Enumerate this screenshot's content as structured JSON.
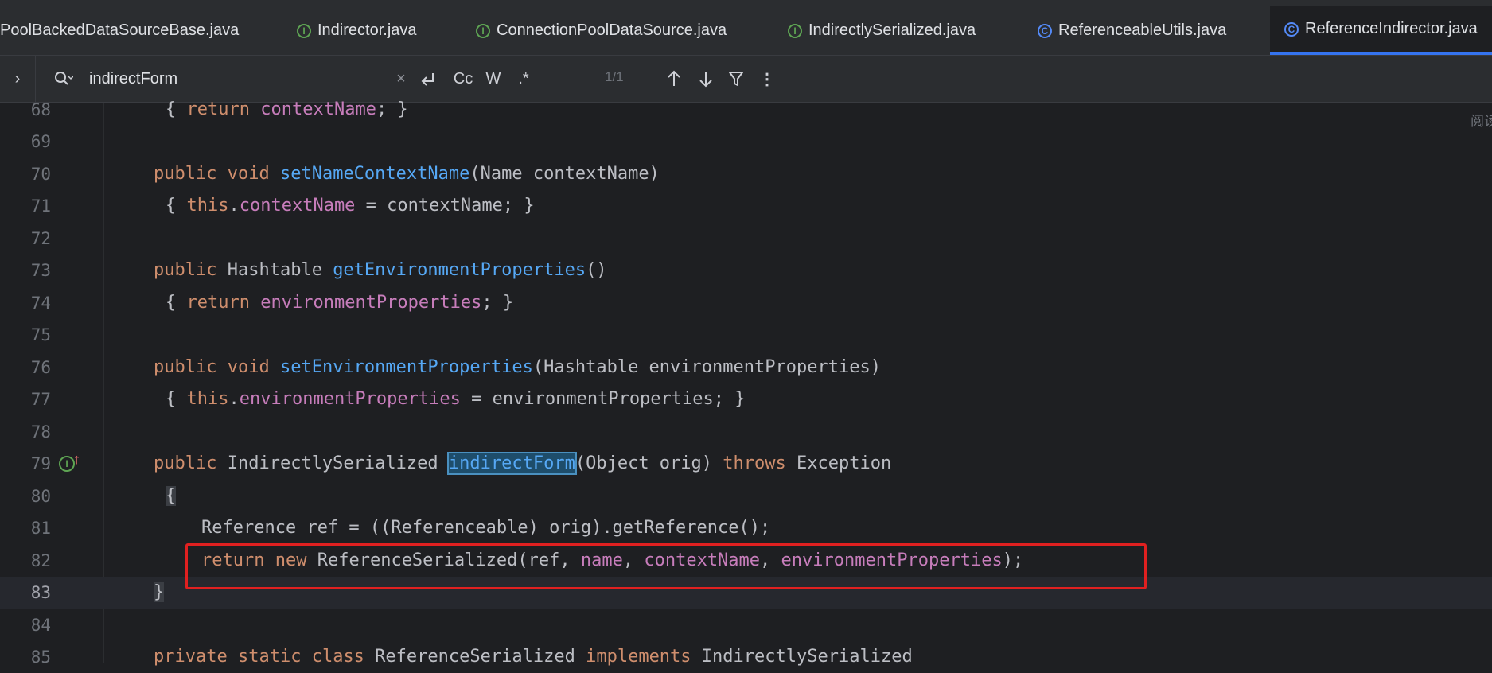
{
  "tabs": [
    {
      "label": "PoolBackedDataSourceBase.java",
      "icon": "none"
    },
    {
      "label": "Indirector.java",
      "icon": "interface-icon"
    },
    {
      "label": "ConnectionPoolDataSource.java",
      "icon": "interface-icon"
    },
    {
      "label": "IndirectlySerialized.java",
      "icon": "interface-icon"
    },
    {
      "label": "ReferenceableUtils.java",
      "icon": "class-icon"
    },
    {
      "label": "ReferenceIndirector.java",
      "icon": "class-icon",
      "active": true
    }
  ],
  "icon_letters": {
    "interface": "I",
    "class": "C"
  },
  "search": {
    "value": "indirectForm",
    "match_count": "1/1",
    "case_label": "Cc",
    "word_label": "W",
    "regex_label": ".*"
  },
  "lines": [
    {
      "num": "68"
    },
    {
      "num": "69"
    },
    {
      "num": "70"
    },
    {
      "num": "71"
    },
    {
      "num": "72"
    },
    {
      "num": "73"
    },
    {
      "num": "74"
    },
    {
      "num": "75"
    },
    {
      "num": "76"
    },
    {
      "num": "77"
    },
    {
      "num": "78"
    },
    {
      "num": "79"
    },
    {
      "num": "80"
    },
    {
      "num": "81"
    },
    {
      "num": "82"
    },
    {
      "num": "83"
    },
    {
      "num": "84"
    },
    {
      "num": "85"
    }
  ],
  "code": {
    "l68": {
      "t1": "{ ",
      "t2": "return",
      "t3": " ",
      "t4": "contextName",
      "t5": "; }"
    },
    "l70": {
      "t1": "public",
      "t2": " ",
      "t3": "void",
      "t4": " ",
      "t5": "setNameContextName",
      "t6": "(Name contextName)"
    },
    "l71": {
      "t1": "{ ",
      "t2": "this",
      "t3": ".",
      "t4": "contextName",
      "t5": " = contextName; }"
    },
    "l73": {
      "t1": "public",
      "t2": " Hashtable ",
      "t3": "getEnvironmentProperties",
      "t4": "()"
    },
    "l74": {
      "t1": "{ ",
      "t2": "return",
      "t3": " ",
      "t4": "environmentProperties",
      "t5": "; }"
    },
    "l76": {
      "t1": "public",
      "t2": " ",
      "t3": "void",
      "t4": " ",
      "t5": "setEnvironmentProperties",
      "t6": "(Hashtable environmentProperties)"
    },
    "l77": {
      "t1": "{ ",
      "t2": "this",
      "t3": ".",
      "t4": "environmentProperties",
      "t5": " = environmentProperties; }"
    },
    "l79": {
      "t1": "public",
      "t2": " IndirectlySerialized ",
      "t3": "indirectForm",
      "t4": "(Object orig) ",
      "t5": "throws",
      "t6": " Exception"
    },
    "l80": {
      "t1": "{"
    },
    "l81": {
      "t1": "Reference ref = ((Referenceable) orig).getReference();"
    },
    "l82": {
      "t1": "return",
      "t2": " ",
      "t3": "new",
      "t4": " ReferenceSerialized(ref, ",
      "t5": "name",
      "t6": ", ",
      "t7": "contextName",
      "t8": ", ",
      "t9": "environmentProperties",
      "t10": ");"
    },
    "l83": {
      "t1": "}"
    },
    "l85": {
      "t1": "private",
      "t2": " ",
      "t3": "static",
      "t4": " ",
      "t5": "class",
      "t6": " ReferenceSerialized ",
      "t7": "implements",
      "t8": " IndirectlySerialized"
    }
  },
  "reader_mode_label": "阅读",
  "colors": {
    "keyword": "#cf8e6d",
    "method": "#56a8f5",
    "field": "#c77dbb",
    "highlight_box": "#e02020",
    "active_tab_underline": "#3574f0"
  }
}
